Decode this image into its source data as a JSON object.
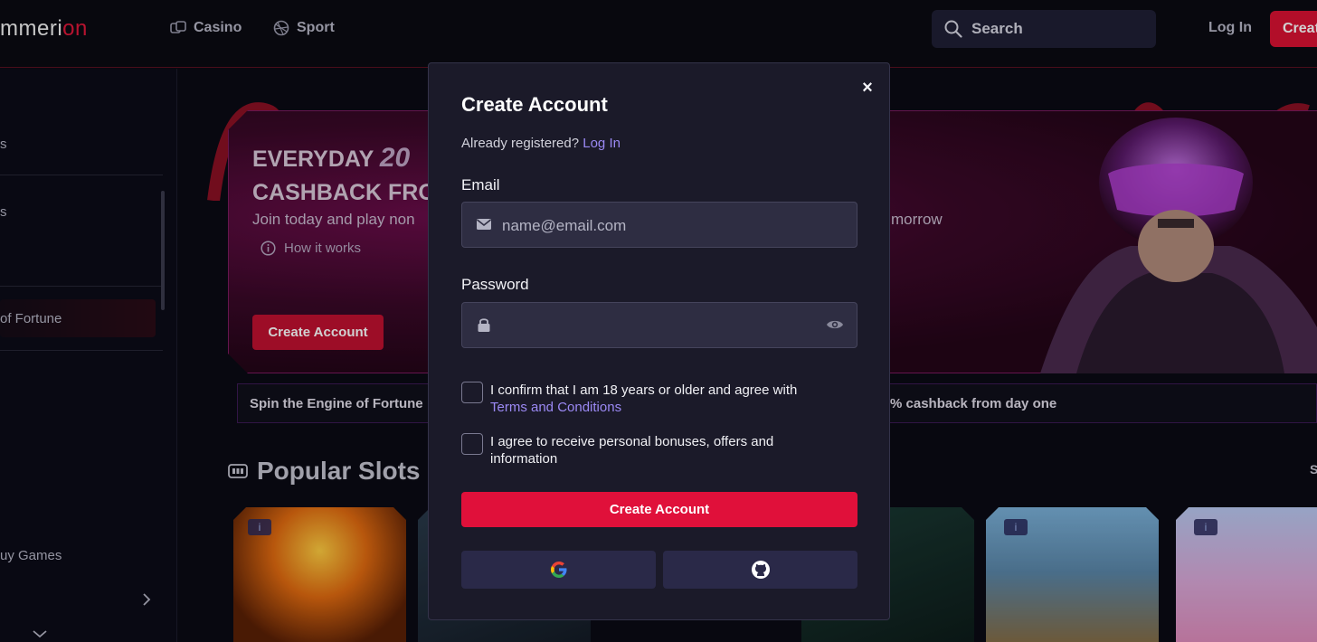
{
  "header": {
    "brand_main": "mmeri",
    "brand_accent": "on",
    "nav": [
      {
        "label": "Casino",
        "icon": "casino-icon"
      },
      {
        "label": "Sport",
        "icon": "sport-icon"
      }
    ],
    "search_label": "Search",
    "login_label": "Log In",
    "create_label": "Creat"
  },
  "sidebar": {
    "items": [
      {
        "label": "s"
      },
      {
        "label": "s"
      },
      {
        "label": "of Fortune"
      },
      {
        "label": "uy Games"
      }
    ]
  },
  "banner": {
    "title_line1_a": "EVERYDAY",
    "title_line1_b": "20",
    "title_line2": "CASHBACK FRO",
    "subtitle_left": "Join today and play non",
    "subtitle_right": "morrow",
    "how_it_works": "How it works",
    "cta": "Create Account"
  },
  "ticker": {
    "left": "Spin the Engine of Fortune",
    "right": "% cashback from day one"
  },
  "slots": {
    "title": "Popular Slots",
    "see_all": "S",
    "info_glyph": "i"
  },
  "modal": {
    "title": "Create Account",
    "already_text": "Already registered?",
    "login_link": "Log In",
    "email_label": "Email",
    "email_placeholder": "name@email.com",
    "password_label": "Password",
    "checkbox1_text": "I confirm that I am 18 years or older and agree with",
    "checkbox1_link": "Terms and Conditions",
    "checkbox2_text": "I agree to receive personal bonuses, offers and information",
    "submit": "Create Account",
    "close_glyph": "×",
    "social": [
      "google-icon",
      "github-icon"
    ]
  },
  "colors": {
    "accent_red": "#e0103a",
    "link_purple": "#9b89f4",
    "modal_bg": "#1b1a29"
  }
}
